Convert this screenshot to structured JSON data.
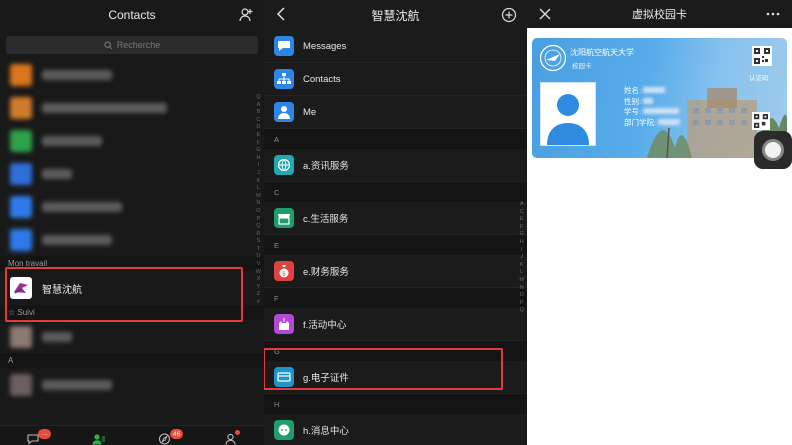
{
  "panel1": {
    "title": "Contacts",
    "search_placeholder": "Recherche",
    "blurred_rows": [
      {
        "color": "#d8761e",
        "width": 70
      },
      {
        "color": "#cf7a2a",
        "width": 125
      },
      {
        "color": "#2fa14b",
        "width": 60
      },
      {
        "color": "#2e6fd9",
        "width": 30
      },
      {
        "color": "#2f7ae8",
        "width": 80
      },
      {
        "color": "#2f7ae8",
        "width": 70
      }
    ],
    "section_work": "Mon travail",
    "work_item_label": "智慧沈航",
    "section_follow": "☆ Suivi",
    "section_a": "A",
    "alphabet": [
      "Q",
      "A",
      "B",
      "C",
      "D",
      "E",
      "F",
      "G",
      "H",
      "I",
      "J",
      "K",
      "L",
      "M",
      "N",
      "O",
      "P",
      "Q",
      "R",
      "S",
      "T",
      "U",
      "V",
      "W",
      "X",
      "Y",
      "Z",
      "#"
    ],
    "tabs": [
      {
        "name": "chats",
        "badge": "···"
      },
      {
        "name": "contacts",
        "badge": ""
      },
      {
        "name": "discover",
        "badge": "46"
      },
      {
        "name": "me",
        "badge": ""
      }
    ]
  },
  "panel2": {
    "title": "智慧沈航",
    "top_items": [
      {
        "label": "Messages",
        "color": "#2d86e5",
        "icon": "chat-bubble-icon"
      },
      {
        "label": "Contacts",
        "color": "#2d86e5",
        "icon": "org-chart-icon"
      },
      {
        "label": "Me",
        "color": "#2d86e5",
        "icon": "person-icon"
      }
    ],
    "sections": [
      {
        "letter": "A",
        "label": "a.资讯服务",
        "color": "#21a8b0",
        "icon": "globe-icon"
      },
      {
        "letter": "C",
        "label": "c.生活服务",
        "color": "#1e9e6a",
        "icon": "shop-icon"
      },
      {
        "letter": "E",
        "label": "e.财务服务",
        "color": "#e0433d",
        "icon": "moneybag-icon"
      },
      {
        "letter": "F",
        "label": "f.活动中心",
        "color": "#b548d6",
        "icon": "castle-icon"
      },
      {
        "letter": "G",
        "label": "g.电子证件",
        "color": "#1e96c8",
        "icon": "id-card-icon"
      },
      {
        "letter": "H",
        "label": "h.消息中心",
        "color": "#1e9e6a",
        "icon": "message-icon"
      }
    ],
    "alphabet": [
      "A",
      "C",
      "E",
      "F",
      "G",
      "H",
      "I",
      "J",
      "K",
      "L",
      "M",
      "N",
      "O",
      "P",
      "Q"
    ]
  },
  "panel3": {
    "title": "虚拟校园卡",
    "card": {
      "school": "沈阳航空航天大学",
      "card_type": "校园卡",
      "auth_code": "认证码",
      "name_label": "姓名:",
      "gender_label": "性别:",
      "id_label": "学号:",
      "dept_label": "部门学院:"
    }
  }
}
